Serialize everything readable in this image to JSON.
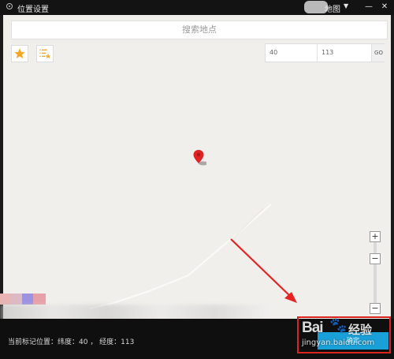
{
  "window": {
    "title": "位置设置",
    "layer_label": "地图",
    "minimize_label": "—",
    "close_label": "✕"
  },
  "map": {
    "search_placeholder": "搜索地点",
    "latitude_value": "40",
    "longitude_value": "113",
    "go_label": "GO",
    "zoom_in_label": "+",
    "zoom_handle_label": "−",
    "zoom_out_label": "−",
    "icons": [
      "star-icon",
      "list-star-icon",
      "map-pin-icon"
    ]
  },
  "status": {
    "text": "当前标记位置：纬度：40 ，  经度：113",
    "confirm_label": "确定"
  },
  "watermark": {
    "brand": "Bai",
    "paw": "🐾",
    "cn": "经验",
    "url": "jingyan.baidu.com"
  },
  "colors": {
    "accent": "#1aa0d8",
    "pin": "#e02424",
    "star": "#f5a623",
    "highlight": "#d9251d"
  }
}
